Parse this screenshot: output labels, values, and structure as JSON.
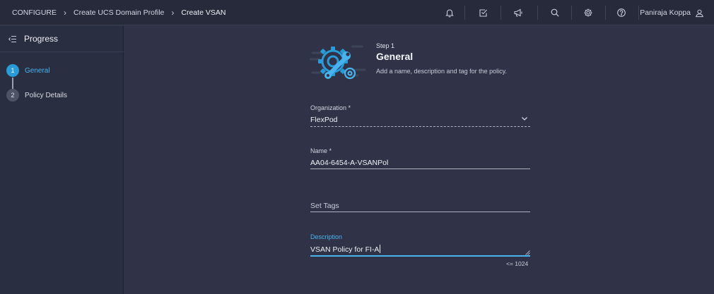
{
  "header": {
    "breadcrumbs": [
      "CONFIGURE",
      "Create UCS Domain Profile",
      "Create VSAN"
    ],
    "user_name": "Paniraja Koppa",
    "icons": [
      "bell-icon",
      "tasks-icon",
      "megaphone-icon",
      "search-icon",
      "gear-icon",
      "help-icon",
      "user-icon"
    ]
  },
  "sidebar": {
    "title": "Progress",
    "steps": [
      {
        "number": "1",
        "label": "General",
        "state": "active"
      },
      {
        "number": "2",
        "label": "Policy Details",
        "state": "pending"
      }
    ]
  },
  "form": {
    "step_tag": "Step 1",
    "title": "General",
    "subtitle": "Add a name, description and tag for the policy.",
    "organization": {
      "label": "Organization *",
      "value": "FlexPod"
    },
    "name": {
      "label": "Name *",
      "value": "AA04-6454-A-VSANPol"
    },
    "tags": {
      "placeholder": "Set Tags"
    },
    "description": {
      "label": "Description",
      "value": "VSAN Policy for FI-A",
      "limit": "<= 1024"
    }
  },
  "colors": {
    "accent": "#49b3ee",
    "header_bg": "#262a3b",
    "panel_bg": "#2a2e41",
    "main_bg": "#303348"
  }
}
